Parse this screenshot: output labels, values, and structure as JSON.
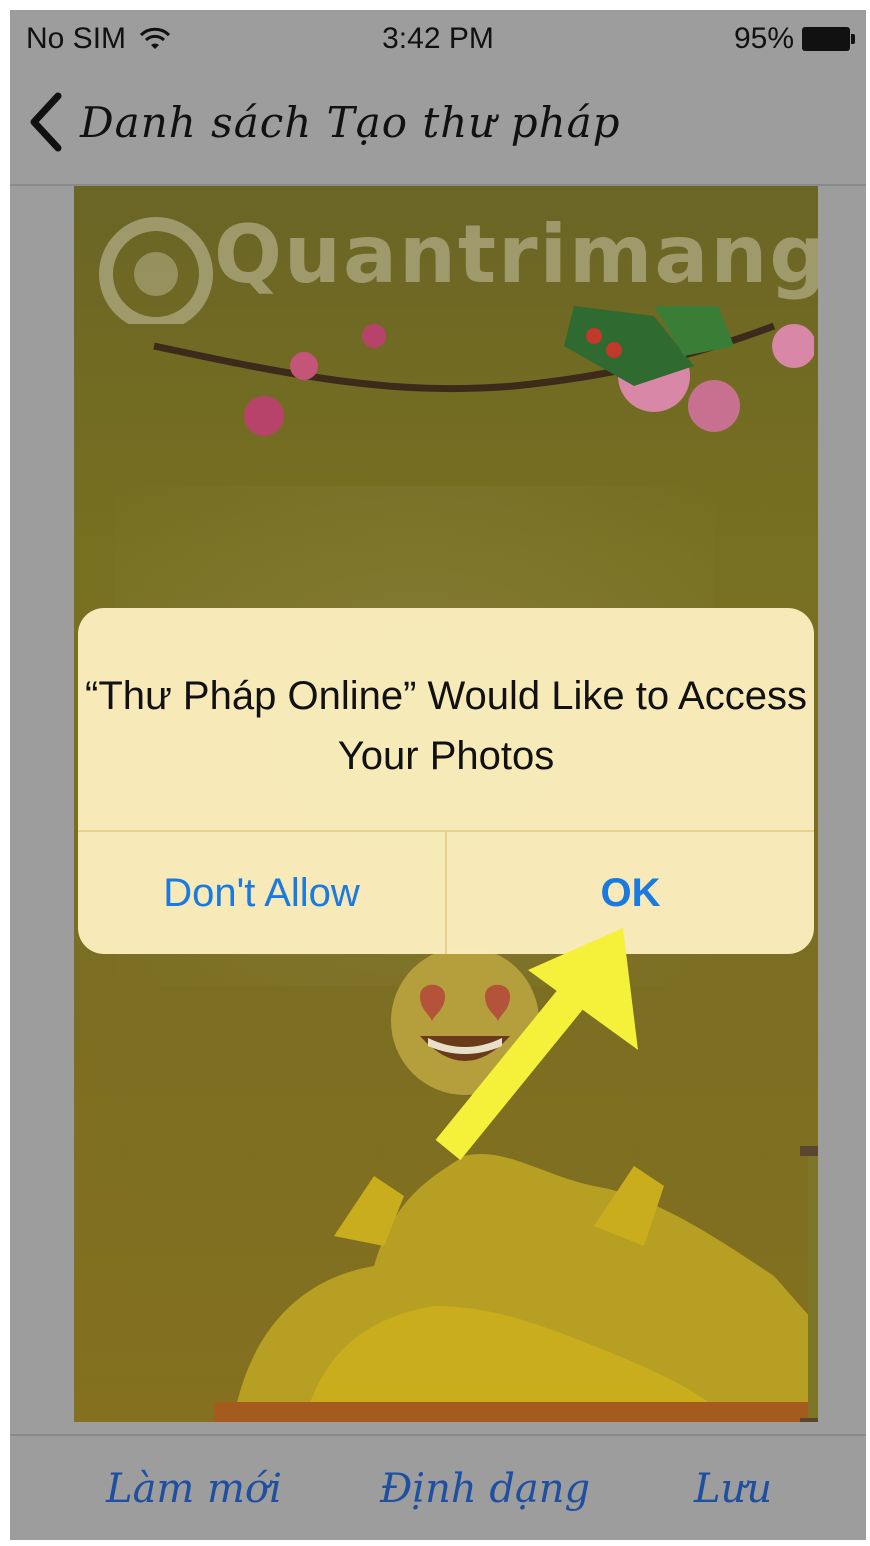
{
  "status_bar": {
    "carrier": "No SIM",
    "time": "3:42 PM",
    "battery": "95%"
  },
  "nav": {
    "back_label": "Danh sách Tạo thư pháp"
  },
  "canvas": {
    "watermark": "Quantrimang"
  },
  "alert": {
    "title": "“Thư Pháp Online” Would Like to Access Your Photos",
    "deny_label": "Don't Allow",
    "ok_label": "OK"
  },
  "toolbar": {
    "new_label": "Làm mới",
    "format_label": "Định dạng",
    "save_label": "Lưu"
  },
  "colors": {
    "accent": "#1a7ae0",
    "alert_bg": "#fceebe",
    "toolbar_text": "#1f4fa0",
    "arrow": "#f5f03a"
  }
}
